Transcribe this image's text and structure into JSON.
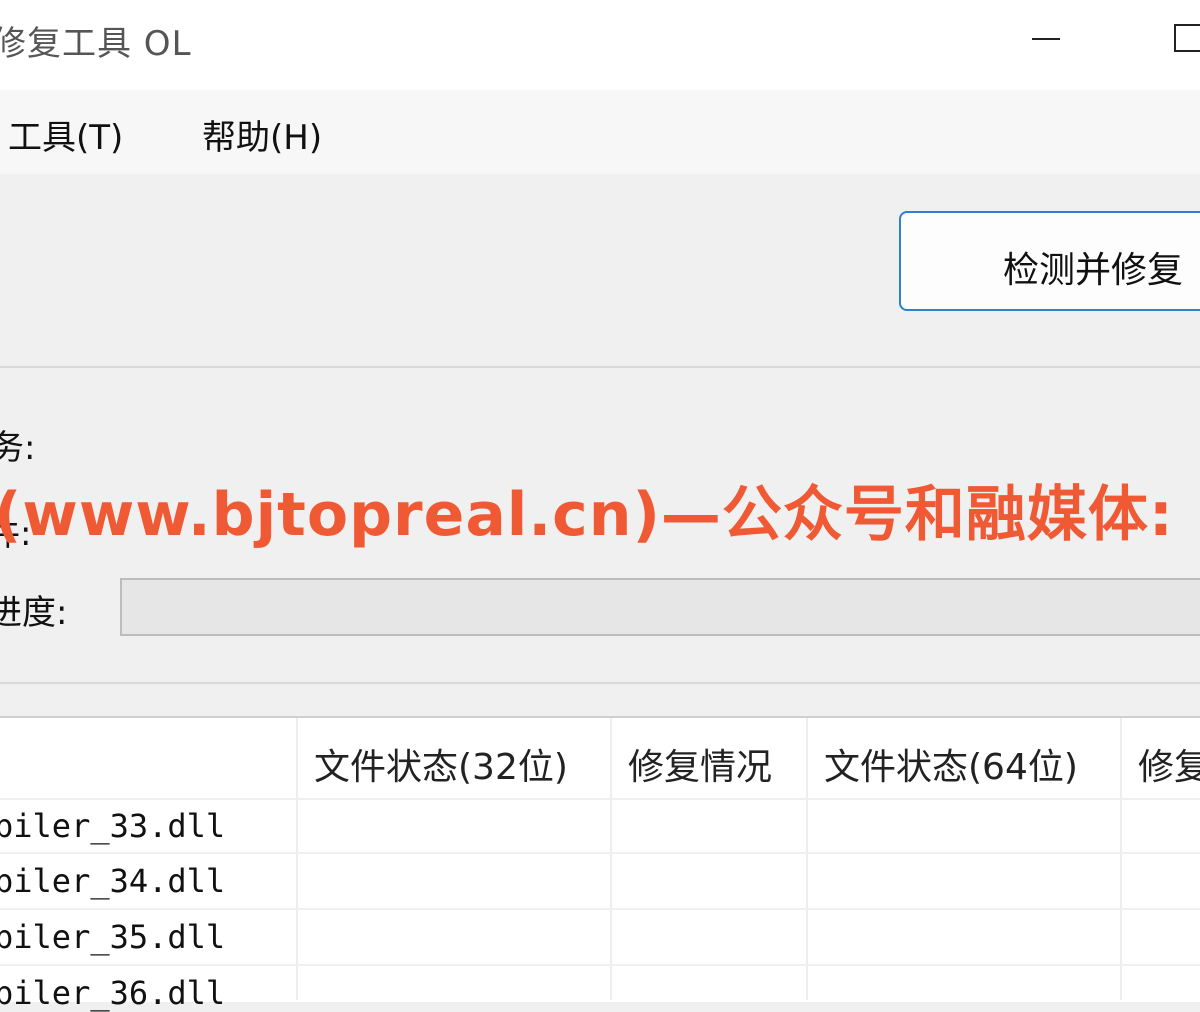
{
  "window": {
    "title": "修复工具 OL"
  },
  "menu": {
    "items": [
      "工具(T)",
      "帮助(H)"
    ]
  },
  "actions": {
    "fix_button_label": "检测并修复"
  },
  "status": {
    "task_label": "务:",
    "file_label": "件:",
    "progress_label": "进度:",
    "progress_value": 0
  },
  "watermark": {
    "text": "(www.bjtopreal.cn)—公众号和融媒体:"
  },
  "table": {
    "headers": [
      "文件状态(32位)",
      "修复情况",
      "文件状态(64位)",
      "修复"
    ],
    "rows": [
      {
        "name": "piler_33.dll"
      },
      {
        "name": "piler_34.dll"
      },
      {
        "name": "piler_35.dll"
      },
      {
        "name": "piler_36.dll"
      }
    ]
  },
  "colors": {
    "accent": "#2f80d0",
    "watermark": "#ef5a35"
  }
}
